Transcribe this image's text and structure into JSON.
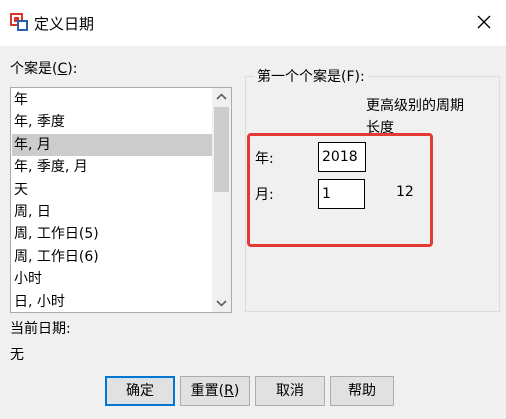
{
  "dialog": {
    "title": "定义日期",
    "cases_label_prefix": "个案是(",
    "cases_label_key": "C",
    "cases_label_suffix": "):",
    "cases_list": [
      "年",
      "年, 季度",
      "年, 月",
      "年, 季度, 月",
      "天",
      "周, 日",
      "周, 工作日(5)",
      "周, 工作日(6)",
      "小时",
      "日, 小时"
    ],
    "selected_index": 2,
    "current_date_label": "当前日期:",
    "current_date_value": "无"
  },
  "first_case": {
    "group_title": "第一个个案是(F):",
    "higher_period_line1": "更高级别的周期",
    "higher_period_line2": "长度",
    "year_label": "年:",
    "year_value": "2018",
    "month_label": "月:",
    "month_value": "1",
    "month_period": "12"
  },
  "buttons": {
    "ok": "确定",
    "reset_prefix": "重置(",
    "reset_key": "R",
    "reset_suffix": ")",
    "cancel": "取消",
    "help": "帮助"
  },
  "colors": {
    "accent": "#0078d7",
    "highlight": "#e53935",
    "selection": "#cccccc",
    "icon_red": "#d9342b",
    "icon_blue": "#2a5db0"
  }
}
